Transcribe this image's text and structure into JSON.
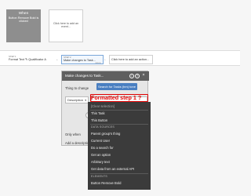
{
  "event": {
    "when_label": "When",
    "when_sub": "Button Remove Bold is clicked",
    "add_event_label": "Click here to add an event..."
  },
  "actions": {
    "step1": {
      "step": "STEP 1",
      "name": "Format Text ✎ Qualificator A"
    },
    "step2": {
      "step": "STEP 2",
      "name": "Make changes to Task...",
      "sub": "delete"
    },
    "add_action_label": "Click here to add an action..."
  },
  "editor": {
    "title": "Make changes to Task...",
    "thing_label": "Thing to change",
    "search_button": "Search for Tasks (hm) tone",
    "field_value": "Description",
    "only_when_label": "Only when",
    "add_description_label": "Add a description"
  },
  "annotation": {
    "text": "Formatted step 1 ?",
    "color": "#e10000"
  },
  "dropdown": {
    "clear_selection": "[Clear selection]",
    "top_items": [
      "This Task",
      "This Button"
    ],
    "data_sources_header": "DATA SOURCES",
    "data_sources": [
      "Parent group's thing",
      "Current User",
      "Do a search for",
      "Get an option",
      "Arbitrary text",
      "Get data from an external API"
    ],
    "elements_header": "ELEMENTS",
    "elements": [
      "Button Remove Bold"
    ]
  },
  "colors": {
    "accent": "#4a7fc1",
    "editor_header": "#5f5f5f",
    "dropdown_bg": "#3b3b3b"
  }
}
